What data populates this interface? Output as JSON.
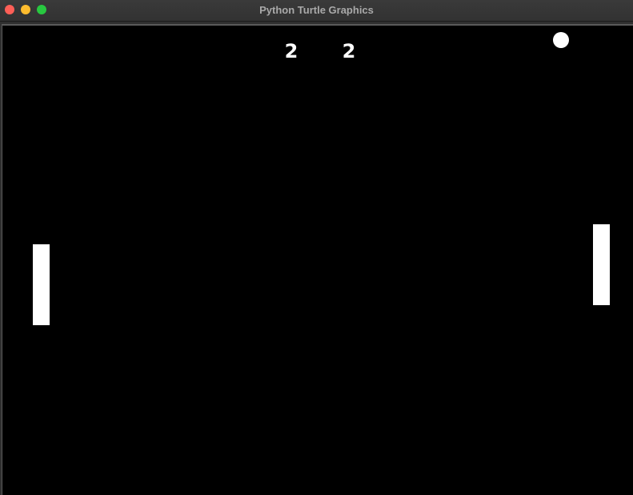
{
  "window": {
    "title": "Python Turtle Graphics"
  },
  "colors": {
    "background": "#000000",
    "foreground": "#ffffff",
    "close": "#fe5f57",
    "minimize": "#febc2e",
    "zoom": "#28c840"
  },
  "game": {
    "score_left": "2",
    "score_right": "2"
  }
}
